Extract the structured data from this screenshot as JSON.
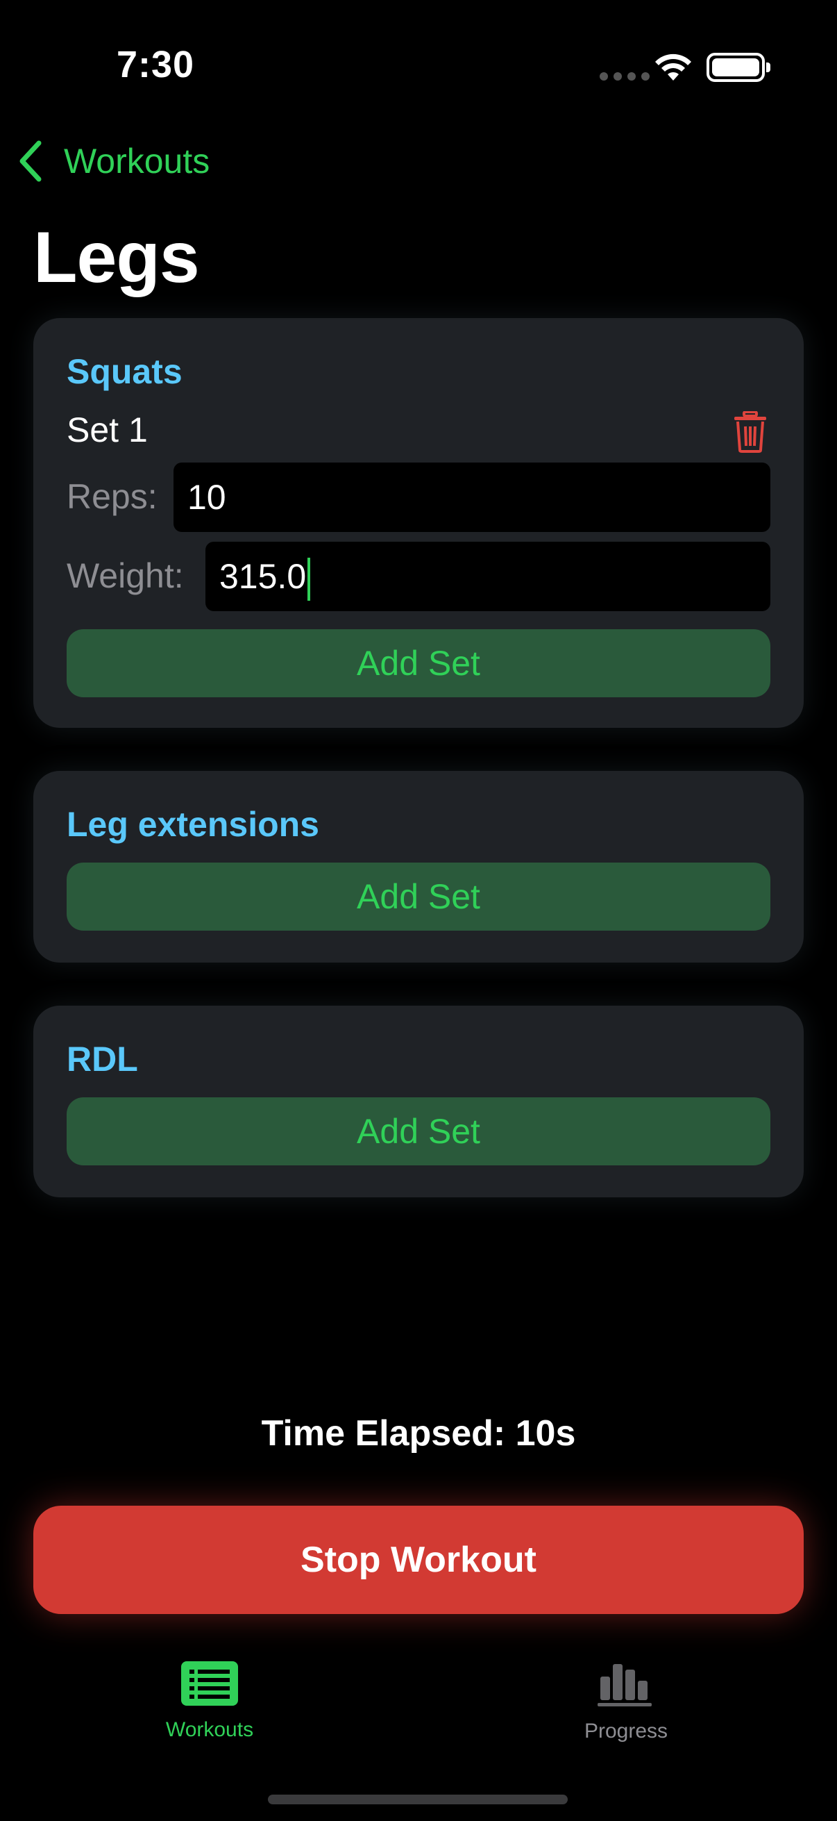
{
  "status_bar": {
    "time": "7:30"
  },
  "nav": {
    "back_label": "Workouts",
    "title": "Legs"
  },
  "exercises": [
    {
      "name": "Squats",
      "sets": [
        {
          "label": "Set 1",
          "reps_label": "Reps:",
          "reps_value": "10",
          "weight_label": "Weight:",
          "weight_value": "315.0"
        }
      ],
      "add_set_label": "Add Set"
    },
    {
      "name": "Leg extensions",
      "sets": [],
      "add_set_label": "Add Set"
    },
    {
      "name": "RDL",
      "sets": [],
      "add_set_label": "Add Set"
    }
  ],
  "timer": {
    "text": "Time Elapsed: 10s"
  },
  "stop_button": {
    "label": "Stop Workout"
  },
  "tab_bar": {
    "tabs": [
      {
        "label": "Workouts",
        "icon": "list-icon",
        "active": true
      },
      {
        "label": "Progress",
        "icon": "chart-icon",
        "active": false
      }
    ]
  },
  "colors": {
    "accent": "#30d158",
    "exercise_title": "#5ac8fa",
    "danger": "#d23a33",
    "card": "#1f2226",
    "add_button_bg": "#2a5a3b"
  }
}
